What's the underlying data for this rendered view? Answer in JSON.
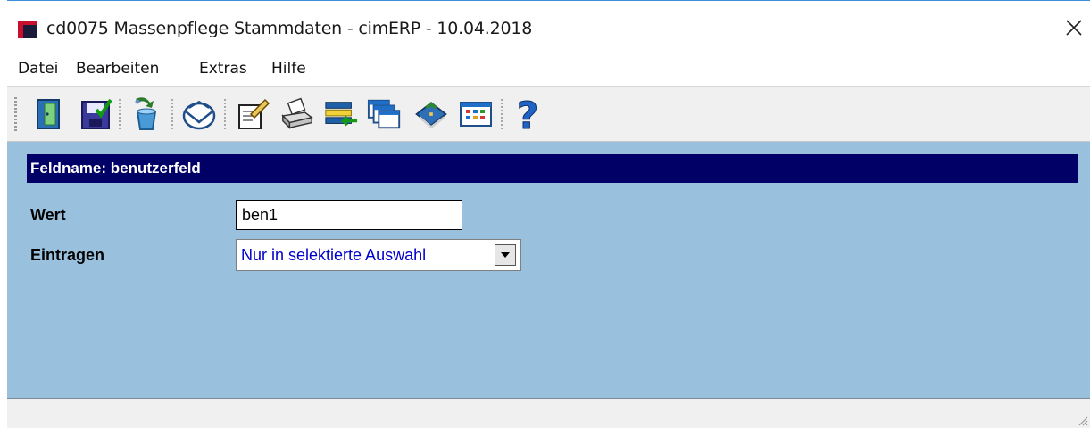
{
  "window": {
    "title": "cd0075 Massenpflege Stammdaten - cimERP - 10.04.2018"
  },
  "menu": [
    {
      "label": "Datei"
    },
    {
      "label": "Bearbeiten"
    },
    {
      "label": "Extras"
    },
    {
      "label": "Hilfe"
    }
  ],
  "toolbar": {
    "buttons": [
      {
        "icon": "exit-door-icon"
      },
      {
        "icon": "save-icon"
      },
      {
        "icon": "recycle-icon"
      },
      {
        "icon": "mail-icon"
      },
      {
        "icon": "edit-document-icon"
      },
      {
        "icon": "printer-icon"
      },
      {
        "icon": "transfer-list-icon"
      },
      {
        "icon": "windows-icon"
      },
      {
        "icon": "book-icon"
      },
      {
        "icon": "grid-view-icon"
      },
      {
        "icon": "help-icon"
      }
    ]
  },
  "form": {
    "header": "Feldname: benutzerfeld",
    "wert_label": "Wert",
    "wert_value": "ben1",
    "eintragen_label": "Eintragen",
    "eintragen_value": "Nur in selektierte Auswahl"
  },
  "colors": {
    "content_bg": "#99c0dc",
    "header_bg": "#000066",
    "select_text": "#0000cc"
  }
}
